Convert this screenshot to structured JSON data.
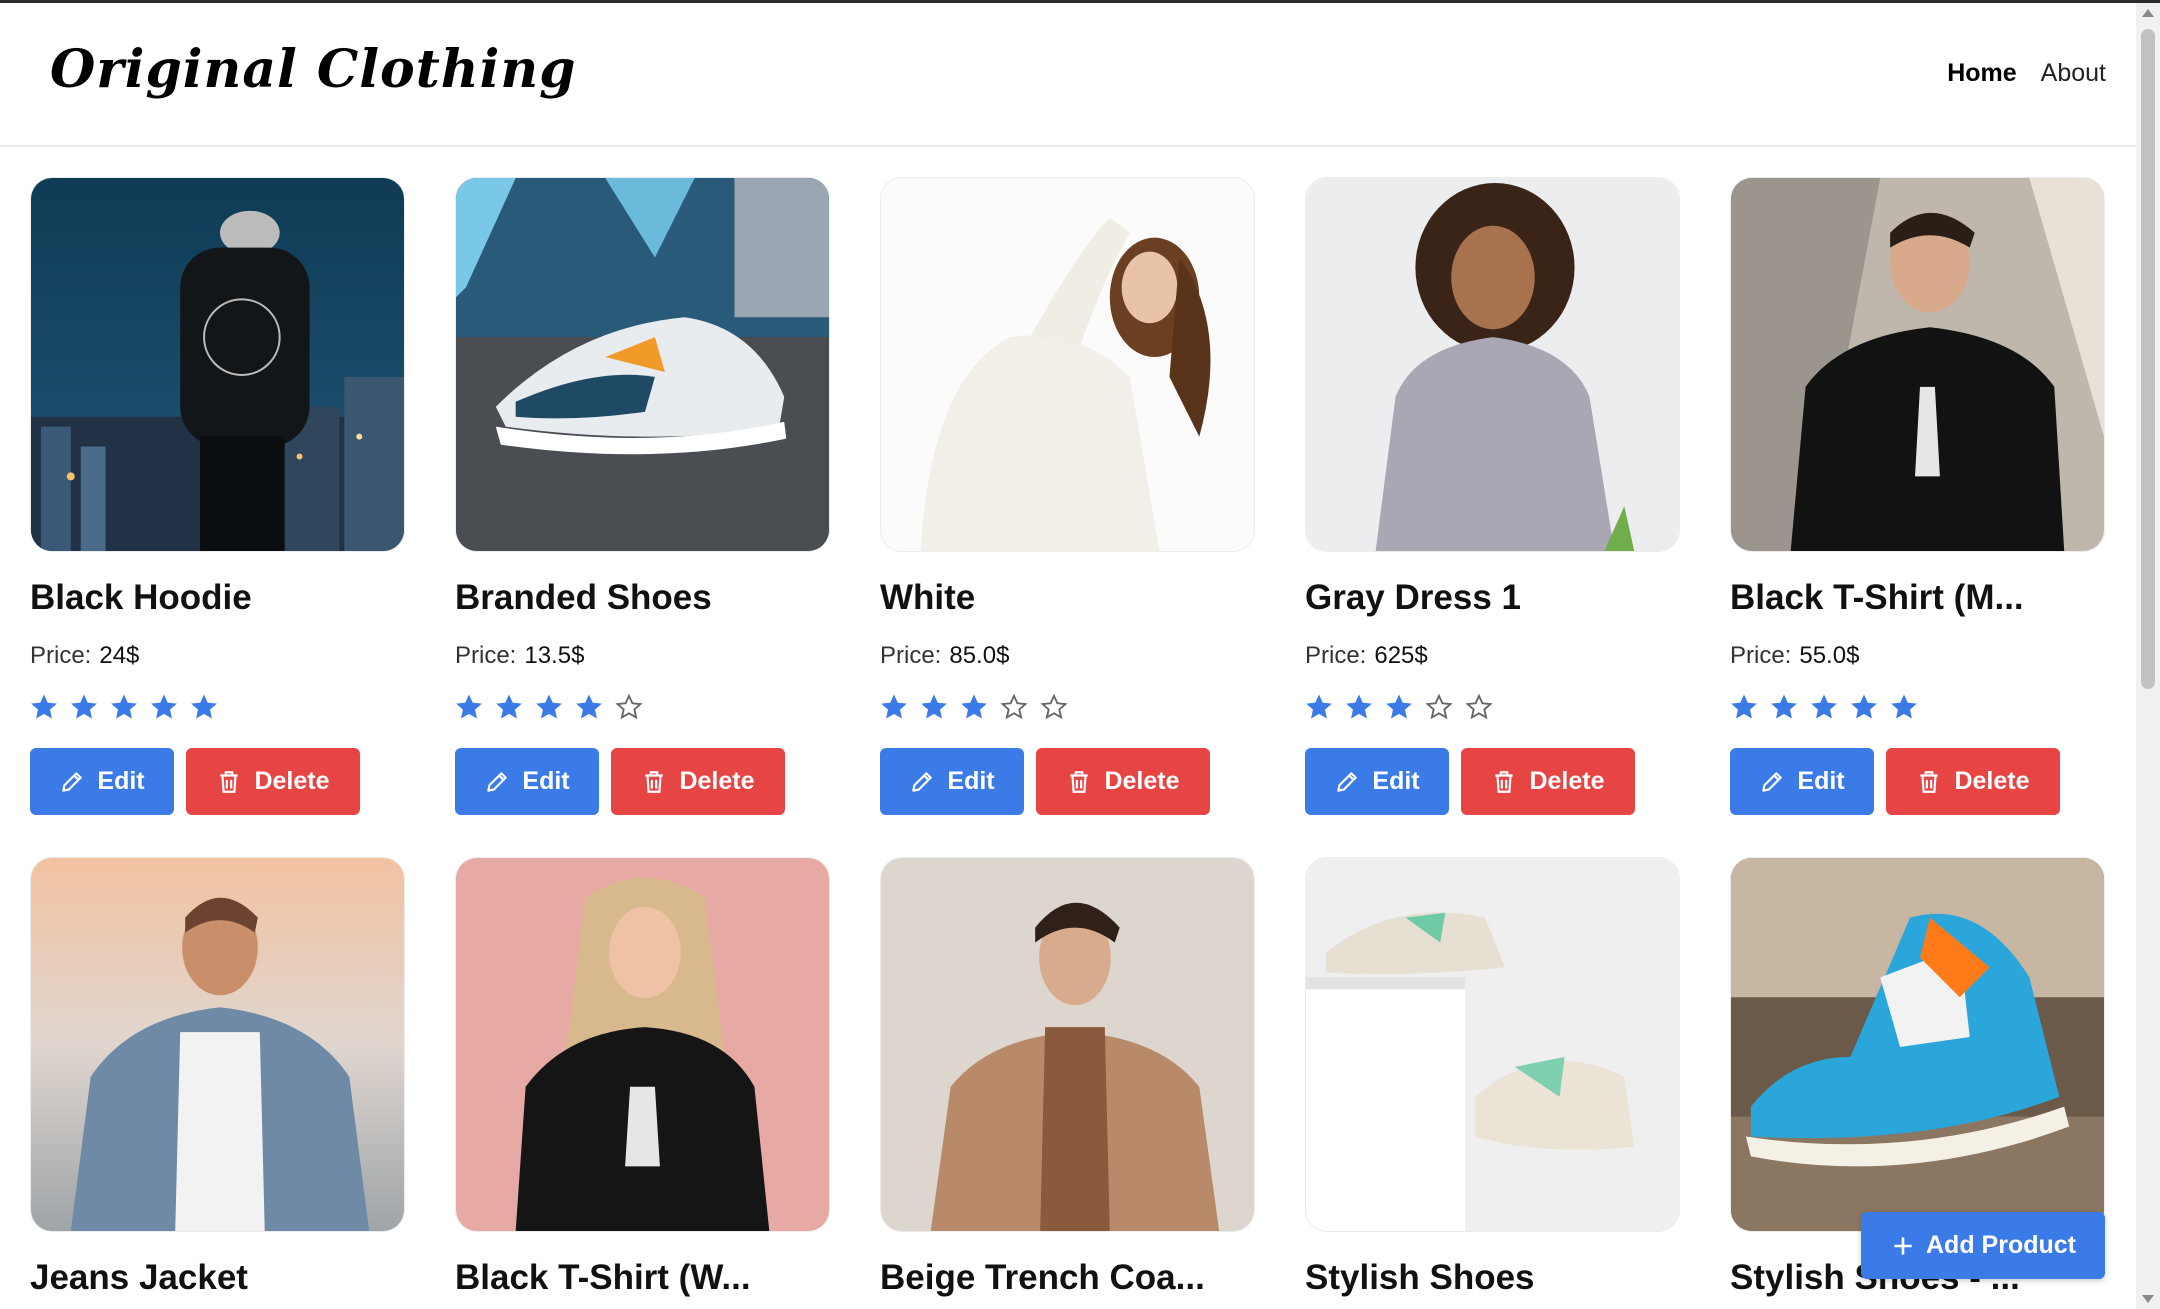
{
  "header": {
    "logo": "Original Clothing",
    "nav": [
      {
        "label": "Home",
        "active": true
      },
      {
        "label": "About",
        "active": false
      }
    ]
  },
  "labels": {
    "price": "Price:",
    "edit": "Edit",
    "delete": "Delete",
    "add_product": "Add Product"
  },
  "colors": {
    "primary": "#3b7be8",
    "danger": "#e74444",
    "star_filled": "#3b7be8"
  },
  "products": [
    {
      "title": "Black Hoodie",
      "price": "24$",
      "rating": 5,
      "max_rating": 5
    },
    {
      "title": "Branded Shoes",
      "price": "13.5$",
      "rating": 4,
      "max_rating": 5
    },
    {
      "title": "White",
      "price": "85.0$",
      "rating": 3,
      "max_rating": 5
    },
    {
      "title": "Gray Dress 1",
      "price": "625$",
      "rating": 3,
      "max_rating": 5
    },
    {
      "title": "Black T-Shirt (M...",
      "price": "55.0$",
      "rating": 5,
      "max_rating": 5
    },
    {
      "title": "Jeans Jacket"
    },
    {
      "title": "Black T-Shirt (W..."
    },
    {
      "title": "Beige Trench Coa..."
    },
    {
      "title": "Stylish Shoes"
    },
    {
      "title": "Stylish Shoes - ..."
    }
  ]
}
